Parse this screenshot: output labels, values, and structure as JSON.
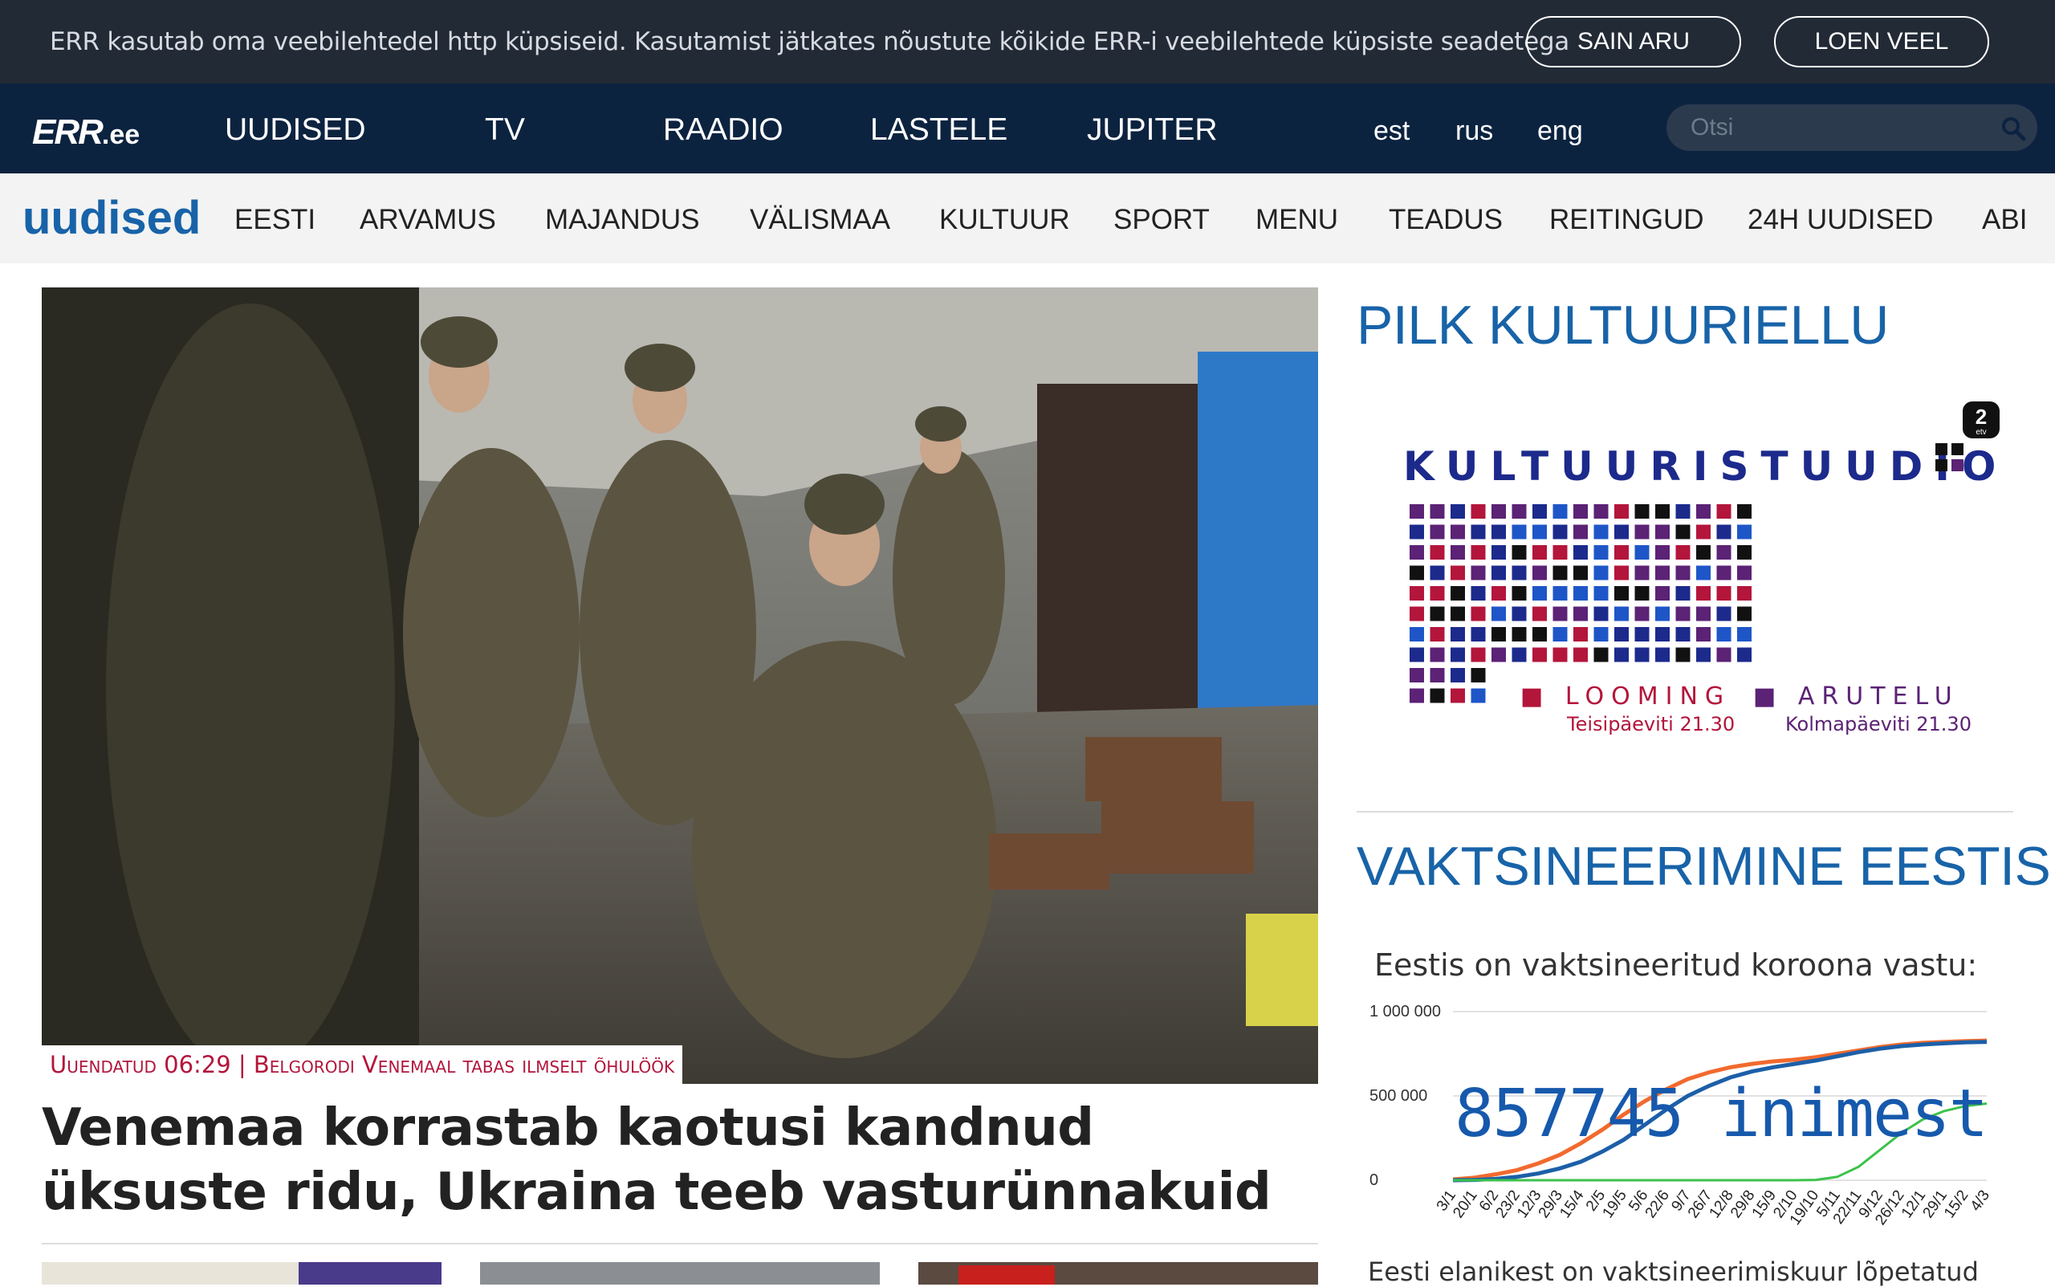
{
  "cookie_bar": {
    "text": "ERR kasutab oma veebilehtedel http küpsiseid. Kasutamist jätkates nõustute kõikide ERR-i veebilehtede küpsiste seadetega",
    "agree_label": "SAIN ARU",
    "more_label": "LOEN VEEL"
  },
  "header": {
    "logo_main": "ERR",
    "logo_suffix": ".ee",
    "nav": [
      "UUDISED",
      "TV",
      "RAADIO",
      "LASTELE",
      "JUPITER"
    ],
    "languages": [
      "est",
      "rus",
      "eng"
    ],
    "search_placeholder": "Otsi"
  },
  "section_nav": {
    "title": "uudised",
    "items": [
      "EESTI",
      "ARVAMUS",
      "MAJANDUS",
      "VÄLISMAA",
      "KULTUUR",
      "SPORT",
      "MENU",
      "TEADUS",
      "REITINGUD",
      "24H UUDISED",
      "ABI"
    ]
  },
  "hero": {
    "caption": "Uuendatud 06:29 | Belgorodi Venemaal tabas ilmselt õhulöök",
    "headline": "Venemaa korrastab kaotusi kandnud üksuste ridu, Ukraina teeb vasturünnakuid"
  },
  "sidebar": {
    "promo_heading": "PILK KULTUURIELLU",
    "promo": {
      "title": "KULTUURISTUUDIO",
      "channel": "2",
      "channel_sub": "etv",
      "shows": [
        {
          "name": "LOOMING",
          "time": "Teisipäeviti 21.30"
        },
        {
          "name": "ARUTELU",
          "time": "Kolmapäeviti 21.30"
        }
      ],
      "colors": [
        "#1c2a8c",
        "#b3153b",
        "#5b2275",
        "#111111",
        "#1e56c8"
      ]
    },
    "vaccine_heading": "VAKTSINEERIMINE EESTIS",
    "vaccine_intro": "Eestis on vaktsineeritud koroona vastu:",
    "vaccine_count": "857745 inimest",
    "bottom_text": "Eesti elanikest on vaktsineerimiskuur lõpetatud"
  },
  "chart_data": {
    "type": "line",
    "title": "",
    "ylim": [
      0,
      1000000
    ],
    "ytick_labels": [
      "1 000 000",
      "500 000",
      "0"
    ],
    "yticks": [
      1000000,
      500000,
      0
    ],
    "categories": [
      "3/1",
      "20/1",
      "6/2",
      "23/2",
      "12/3",
      "29/3",
      "15/4",
      "2/5",
      "19/5",
      "5/6",
      "22/6",
      "9/7",
      "26/7",
      "12/8",
      "29/8",
      "15/9",
      "2/10",
      "19/10",
      "5/11",
      "22/11",
      "9/12",
      "26/12",
      "12/1",
      "29/1",
      "15/2",
      "4/3"
    ],
    "series": [
      {
        "color": "#f26a2e",
        "values": [
          5000,
          15000,
          35000,
          60000,
          100000,
          150000,
          220000,
          300000,
          390000,
          470000,
          540000,
          600000,
          640000,
          670000,
          690000,
          705000,
          715000,
          730000,
          750000,
          770000,
          790000,
          805000,
          815000,
          820000,
          825000,
          828000
        ]
      },
      {
        "color": "#1c5fa8",
        "values": [
          0,
          2000,
          8000,
          20000,
          40000,
          70000,
          110000,
          170000,
          240000,
          330000,
          420000,
          500000,
          560000,
          610000,
          645000,
          670000,
          690000,
          710000,
          735000,
          760000,
          780000,
          795000,
          805000,
          812000,
          818000,
          820000
        ]
      },
      {
        "color": "#3cc24a",
        "values": [
          0,
          0,
          0,
          0,
          0,
          0,
          0,
          0,
          0,
          0,
          0,
          0,
          0,
          0,
          0,
          0,
          0,
          2000,
          20000,
          80000,
          180000,
          280000,
          360000,
          410000,
          440000,
          455000
        ]
      }
    ]
  }
}
